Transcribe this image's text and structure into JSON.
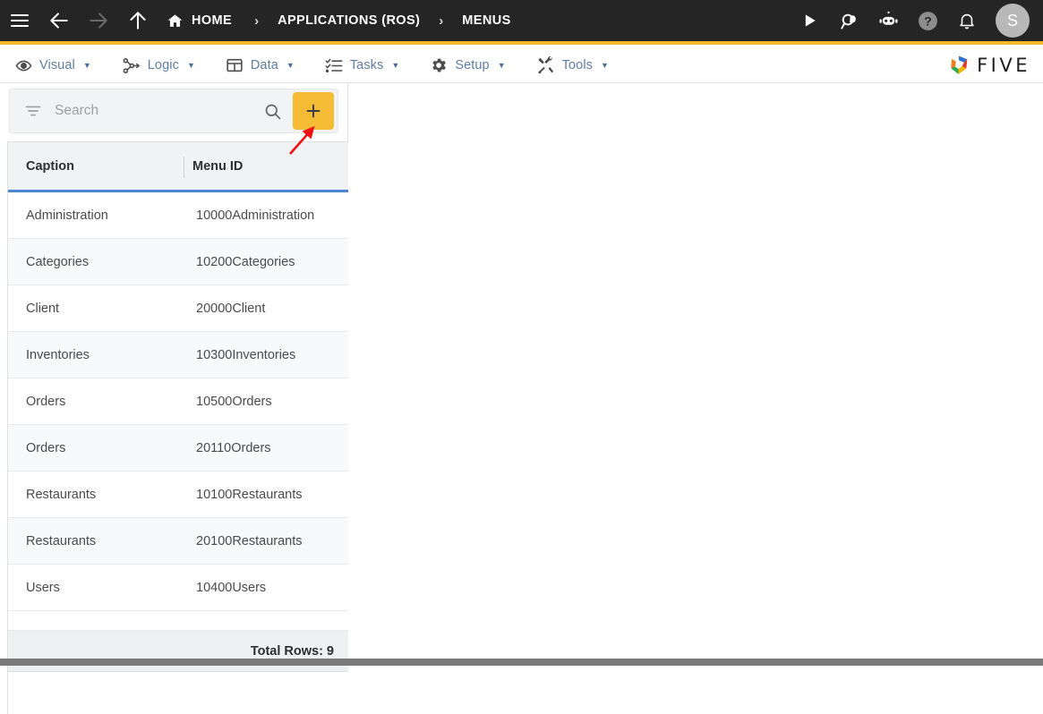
{
  "topbar": {
    "menu_icon": "hamburger-icon",
    "back_icon": "arrow-left-icon",
    "forward_icon": "arrow-right-icon",
    "up_icon": "arrow-up-icon",
    "home_icon": "home-icon",
    "breadcrumb": [
      {
        "label": "HOME",
        "icon": "home-icon"
      },
      {
        "label": "APPLICATIONS (ROS)",
        "icon": ""
      },
      {
        "label": "MENUS",
        "icon": ""
      }
    ],
    "separator": "›",
    "actions": [
      {
        "name": "run-icon",
        "glyph": "play"
      },
      {
        "name": "search-chat-icon",
        "glyph": "search-bubble"
      },
      {
        "name": "assistant-bot-icon",
        "glyph": "bot"
      },
      {
        "name": "help-icon",
        "glyph": "question"
      },
      {
        "name": "notifications-bell-icon",
        "glyph": "bell"
      }
    ],
    "avatar_initial": "S",
    "background": "#252525",
    "accent": "#f5ba2a"
  },
  "menubar": {
    "items": [
      {
        "label": "Visual",
        "icon": "eye-icon"
      },
      {
        "label": "Logic",
        "icon": "logic-nodes-icon"
      },
      {
        "label": "Data",
        "icon": "table-grid-icon"
      },
      {
        "label": "Tasks",
        "icon": "checklist-icon"
      },
      {
        "label": "Setup",
        "icon": "gear-icon"
      },
      {
        "label": "Tools",
        "icon": "tools-icon"
      }
    ],
    "caret": "▼",
    "brand": {
      "text": "FIVE",
      "logo": "five-pinwheel-logo"
    },
    "label_color": "#5b7da6"
  },
  "search": {
    "filter_icon": "filter-icon",
    "placeholder": "Search",
    "value": "",
    "search_icon": "search-icon",
    "add_label": "+",
    "add_button_color": "#f5bb34"
  },
  "table": {
    "columns": [
      "Caption",
      "Menu ID"
    ],
    "rows": [
      {
        "caption": "Administration",
        "menu_id": "10000Administration"
      },
      {
        "caption": "Categories",
        "menu_id": "10200Categories"
      },
      {
        "caption": "Client",
        "menu_id": "20000Client"
      },
      {
        "caption": "Inventories",
        "menu_id": "10300Inventories"
      },
      {
        "caption": "Orders",
        "menu_id": "10500Orders"
      },
      {
        "caption": "Orders",
        "menu_id": "20110Orders"
      },
      {
        "caption": "Restaurants",
        "menu_id": "10100Restaurants"
      },
      {
        "caption": "Restaurants",
        "menu_id": "20100Restaurants"
      },
      {
        "caption": "Users",
        "menu_id": "10400Users"
      }
    ],
    "footer": "Total Rows: 9",
    "header_underline_color": "#4a87d3"
  },
  "annotation": {
    "type": "arrow",
    "color": "#ee1111",
    "points_to": "add-button"
  }
}
